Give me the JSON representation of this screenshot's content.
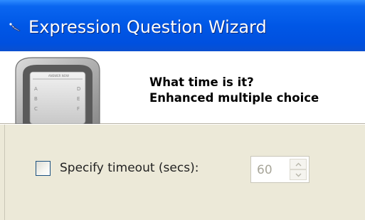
{
  "window": {
    "title": "Expression Question Wizard"
  },
  "question": {
    "title": "What time is it?",
    "type": "Enhanced multiple choice"
  },
  "options": {
    "timeout_checkbox_label": "Specify timeout (secs):",
    "timeout_checked": false,
    "timeout_value": "60",
    "timeout_enabled": false
  },
  "icons": {
    "title_icon": "wand-icon",
    "device_image": "clicker-device-illustration",
    "spinner_up": "chevron-up-icon",
    "spinner_down": "chevron-down-icon"
  },
  "colors": {
    "titlebar": "#0057e6",
    "dialog_background": "#ece9d8",
    "disabled_text": "#a8a69a"
  }
}
